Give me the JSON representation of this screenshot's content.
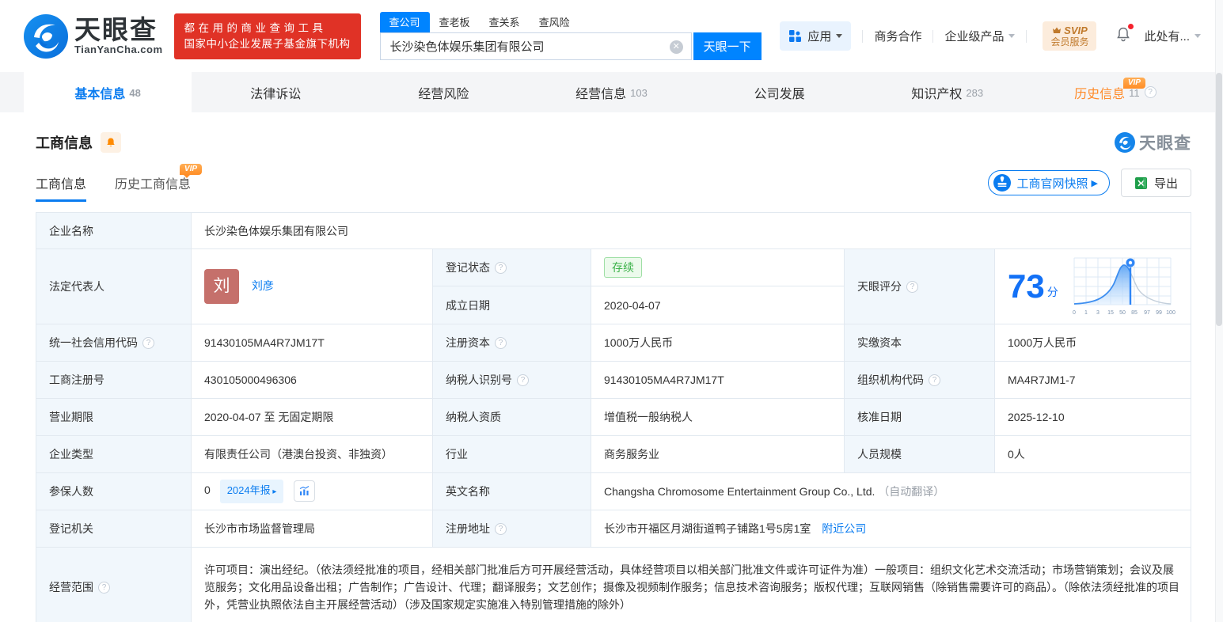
{
  "misc": {
    "vip": "VIP"
  },
  "header": {
    "logo_title": "天眼查",
    "logo_domain": "TianYanCha.com",
    "banner_line1": "都在用的商业查询工具",
    "banner_line2": "国家中小企业发展子基金旗下机构",
    "search_tabs": [
      {
        "label": "查公司"
      },
      {
        "label": "查老板"
      },
      {
        "label": "查关系"
      },
      {
        "label": "查风险"
      }
    ],
    "search_value": "长沙染色体娱乐集团有限公司",
    "search_button": "天眼一下",
    "apps_label": "应用",
    "biz_coop": "商务合作",
    "enterprise_products": "企业级产品",
    "svip_line1": "SVIP",
    "svip_line2": "会员服务",
    "user_label": "此处有..."
  },
  "nav_tabs": [
    {
      "label": "基本信息",
      "count": "48"
    },
    {
      "label": "法律诉讼",
      "count": ""
    },
    {
      "label": "经营风险",
      "count": ""
    },
    {
      "label": "经营信息",
      "count": "103"
    },
    {
      "label": "公司发展",
      "count": ""
    },
    {
      "label": "知识产权",
      "count": "283"
    },
    {
      "label": "历史信息",
      "count": "11"
    }
  ],
  "section": {
    "title": "工商信息",
    "watermark": "天眼查",
    "subtab_active": "工商信息",
    "subtab_history": "历史工商信息",
    "snapshot_button": "工商官网快照",
    "export_button": "导出"
  },
  "table": {
    "company_name": {
      "label": "企业名称",
      "value": "长沙染色体娱乐集团有限公司"
    },
    "legal_rep": {
      "label": "法定代表人",
      "avatar": "刘",
      "name": "刘彦"
    },
    "reg_status": {
      "label": "登记状态",
      "value": "存续"
    },
    "establish_date": {
      "label": "成立日期",
      "value": "2020-04-07"
    },
    "score": {
      "label": "天眼评分",
      "value": "73",
      "unit": "分",
      "axis": [
        "0",
        "1",
        "3",
        "15",
        "50",
        "85",
        "97",
        "99",
        "100"
      ]
    },
    "credit_code": {
      "label": "统一社会信用代码",
      "value": "91430105MA4R7JM17T"
    },
    "reg_capital": {
      "label": "注册资本",
      "value": "1000万人民币"
    },
    "paid_capital": {
      "label": "实缴资本",
      "value": "1000万人民币"
    },
    "reg_number": {
      "label": "工商注册号",
      "value": "430105000496306"
    },
    "taxpayer_id": {
      "label": "纳税人识别号",
      "value": "91430105MA4R7JM17T"
    },
    "org_code": {
      "label": "组织机构代码",
      "value": "MA4R7JM1-7"
    },
    "business_term": {
      "label": "营业期限",
      "value": "2020-04-07 至 无固定期限"
    },
    "taxpayer_quality": {
      "label": "纳税人资质",
      "value": "增值税一般纳税人"
    },
    "approval_date": {
      "label": "核准日期",
      "value": "2025-12-10"
    },
    "company_type": {
      "label": "企业类型",
      "value": "有限责任公司（港澳台投资、非独资）"
    },
    "industry": {
      "label": "行业",
      "value": "商务服务业"
    },
    "staff_size": {
      "label": "人员规模",
      "value": "0人"
    },
    "insured": {
      "label": "参保人数",
      "value": "0",
      "report": "2024年报"
    },
    "english_name": {
      "label": "英文名称",
      "value": "Changsha Chromosome Entertainment Group Co., Ltd.",
      "note": "（自动翻译）"
    },
    "reg_authority": {
      "label": "登记机关",
      "value": "长沙市市场监督管理局"
    },
    "reg_address": {
      "label": "注册地址",
      "value": "长沙市开福区月湖街道鸭子铺路1号5房1室",
      "nearby": "附近公司"
    },
    "business_scope": {
      "label": "经营范围",
      "value": "许可项目：演出经纪。（依法须经批准的项目，经相关部门批准后方可开展经营活动，具体经营项目以相关部门批准文件或许可证件为准）一般项目：组织文化艺术交流活动；市场营销策划；会议及展览服务；文化用品设备出租；广告制作；广告设计、代理；翻译服务；文艺创作；摄像及视频制作服务；信息技术咨询服务；版权代理；互联网销售（除销售需要许可的商品）。（除依法须经批准的项目外，凭营业执照依法自主开展经营活动）（涉及国家规定实施准入特别管理措施的除外）"
    }
  },
  "colors": {
    "brand_blue": "#0084ff",
    "banner_red": "#e03226",
    "vip_orange": "#ff8d26",
    "status_green": "#3cb24a"
  }
}
